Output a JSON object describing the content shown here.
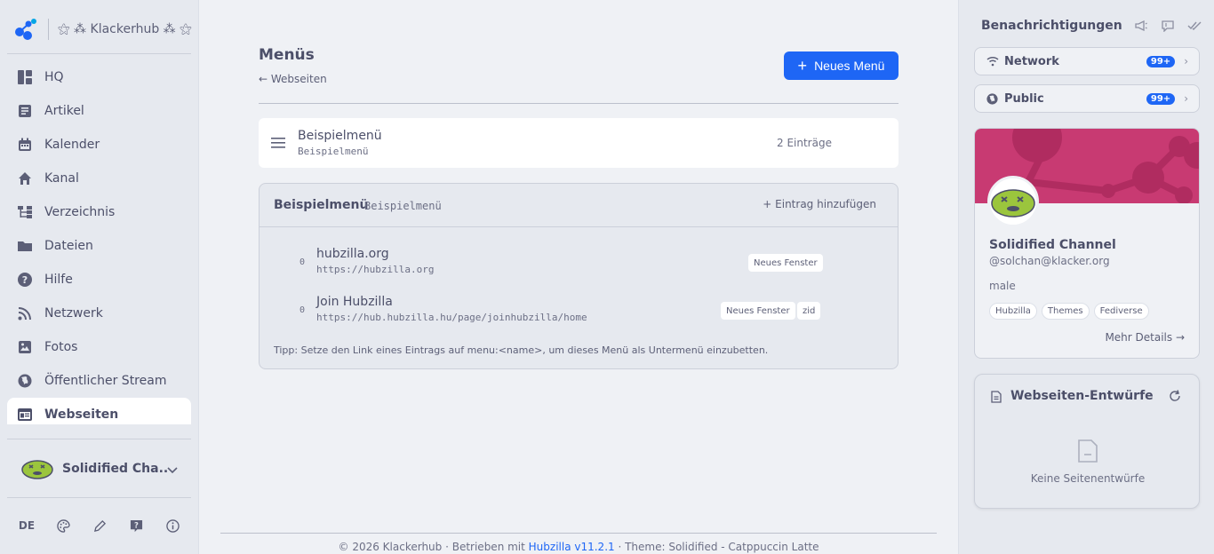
{
  "brand": {
    "site_name": "⚝ ⁂ Klackerhub ⁂ ⚝"
  },
  "sidebar": {
    "items": [
      {
        "label": "HQ",
        "icon": "dashboard-icon"
      },
      {
        "label": "Artikel",
        "icon": "article-icon"
      },
      {
        "label": "Kalender",
        "icon": "calendar-icon"
      },
      {
        "label": "Kanal",
        "icon": "home-icon"
      },
      {
        "label": "Verzeichnis",
        "icon": "directory-icon"
      },
      {
        "label": "Dateien",
        "icon": "folder-icon"
      },
      {
        "label": "Hilfe",
        "icon": "help-icon"
      },
      {
        "label": "Netzwerk",
        "icon": "rss-icon"
      },
      {
        "label": "Fotos",
        "icon": "photo-icon"
      },
      {
        "label": "Öffentlicher Stream",
        "icon": "globe-icon"
      },
      {
        "label": "Webseiten",
        "icon": "webpage-icon",
        "active": true
      }
    ],
    "profile_name": "Solidified Cha...",
    "language": "DE"
  },
  "main": {
    "title": "Menüs",
    "back_link": "← Webseiten",
    "new_button": "Neues Menü",
    "menu": {
      "title": "Beispielmenü",
      "subtitle": "Beispielmenü",
      "count": "2 Einträge"
    },
    "entries_panel": {
      "title": "Beispielmenü",
      "subtitle": "Beispielmenü",
      "add_label": "Eintrag hinzufügen",
      "entries": [
        {
          "index": "0",
          "name": "hubzilla.org",
          "url": "https://hubzilla.org",
          "badges": [
            "Neues Fenster"
          ]
        },
        {
          "index": "0",
          "name": "Join Hubzilla",
          "url": "https://hub.hubzilla.hu/page/joinhubzilla/home",
          "badges": [
            "Neues Fenster",
            "zid"
          ]
        }
      ],
      "tip": "Tipp: Setze den Link eines Eintrags auf menu:<name>, um dieses Menü als Untermenü einzubetten."
    },
    "footer": {
      "prefix": "© 2026 Klackerhub · Betrieben mit ",
      "link": "Hubzilla v11.2.1",
      "suffix": " · Theme: Solidified - Catppuccin Latte"
    }
  },
  "right": {
    "notifications_title": "Benachrichtigungen",
    "pills": [
      {
        "label": "Network",
        "count": "99+"
      },
      {
        "label": "Public",
        "count": "99+"
      }
    ],
    "profile": {
      "name": "Solidified Channel",
      "handle": "@solchan@klacker.org",
      "gender": "male",
      "tags": [
        "Hubzilla",
        "Themes",
        "Fediverse"
      ],
      "more": "Mehr Details →"
    },
    "drafts": {
      "title": "Webseiten-Entwürfe",
      "empty": "Keine Seitenentwürfe"
    }
  },
  "colors": {
    "accent": "#1e66f5",
    "cover": "#c83a72",
    "online": "#40a02b"
  }
}
